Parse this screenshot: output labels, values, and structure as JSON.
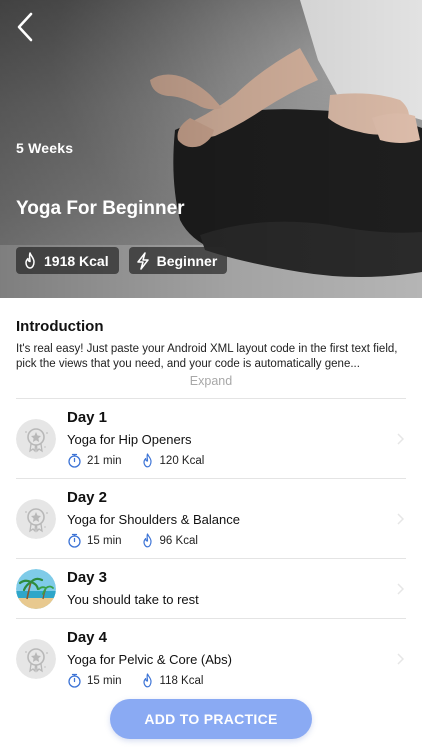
{
  "hero": {
    "duration": "5 Weeks",
    "title": "Yoga For Beginner",
    "chips": [
      {
        "icon": "flame-icon",
        "label": "1918 Kcal"
      },
      {
        "icon": "lightning-icon",
        "label": "Beginner"
      }
    ]
  },
  "intro": {
    "heading": "Introduction",
    "description": "It's real easy! Just paste your Android XML layout code in the first text field, pick the views that you need, and your code is automatically gene...",
    "expand_label": "Expand"
  },
  "days": [
    {
      "day": "Day 1",
      "title": "Yoga for Hip Openers",
      "time": "21 min",
      "kcal": "120 Kcal",
      "avatar": "medal-icon"
    },
    {
      "day": "Day 2",
      "title": "Yoga for Shoulders & Balance",
      "time": "15 min",
      "kcal": "96 Kcal",
      "avatar": "medal-icon"
    },
    {
      "day": "Day 3",
      "title": "You should take to rest",
      "avatar": "beach-icon"
    },
    {
      "day": "Day 4",
      "title": "Yoga for Pelvic & Core (Abs)",
      "time": "15 min",
      "kcal": "118 Kcal",
      "avatar": "medal-icon"
    }
  ],
  "cta": {
    "label": "ADD TO PRACTICE"
  },
  "colors": {
    "accent": "#8aaaf3",
    "icon_blue": "#3d74d6"
  }
}
